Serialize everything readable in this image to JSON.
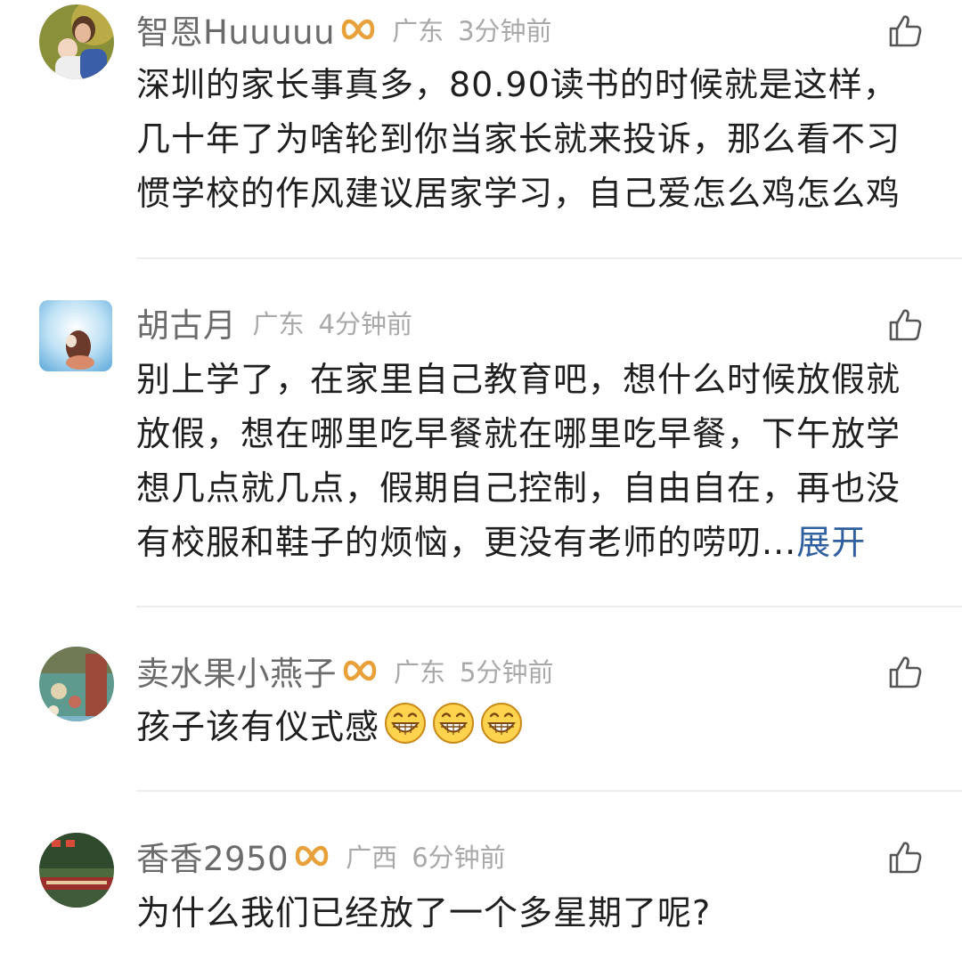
{
  "comments": [
    {
      "username": "智恩Huuuuu",
      "region": "广东",
      "time": "3分钟前",
      "has_badge": true,
      "lines": [
        "深圳的家长事真多，80.90读书的时候就是这样，",
        "几十年了为啥轮到你当家长就来投诉，那么看不习",
        "惯学校的作风建议居家学习，自己爱怎么鸡怎么鸡"
      ]
    },
    {
      "username": "胡古月",
      "region": "广东",
      "time": "4分钟前",
      "has_badge": false,
      "lines": [
        "别上学了，在家里自己教育吧，想什么时候放假就",
        "放假，想在哪里吃早餐就在哪里吃早餐，下午放学",
        "想几点就几点，假期自己控制，自由自在，再也没",
        "有校服和鞋子的烦恼，更没有老师的唠叨..."
      ],
      "expand_label": "展开"
    },
    {
      "username": "卖水果小燕子",
      "region": "广东",
      "time": "5分钟前",
      "has_badge": true,
      "lines": [
        "孩子该有仪式感"
      ],
      "emoji": "grinning-face-icon"
    },
    {
      "username": "香香2950",
      "region": "广西",
      "time": "6分钟前",
      "has_badge": true,
      "lines": [
        "为什么我们已经放了一个多星期了呢?"
      ]
    }
  ],
  "icons": {
    "like": "thumbs-up-icon",
    "badge": "infinity-badge-icon"
  },
  "colors": {
    "username": "#6b6b6b",
    "meta": "#a9a9a9",
    "text": "#1f1f1f",
    "expand": "#2f5f9f",
    "badge": "#e8a13a",
    "divider": "#ededed"
  }
}
